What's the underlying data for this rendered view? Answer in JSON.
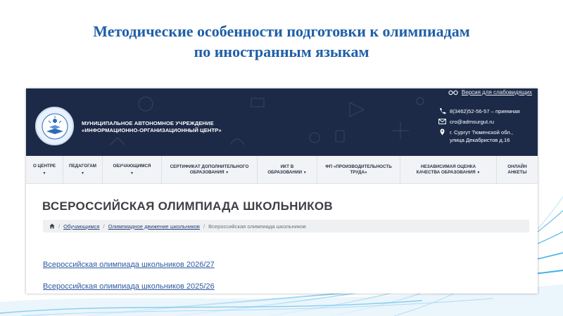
{
  "slide": {
    "title_line1": "Методические особенности подготовки к олимпиадам",
    "title_line2": "по иностранным языкам",
    "title_color": "#1f5fa8"
  },
  "site": {
    "header": {
      "low_vision_link": "Версия для слабовидящих",
      "org_name_line1": "МУНИЦИПАЛЬНОЕ АВТОНОМНОЕ УЧРЕЖДЕНИЕ",
      "org_name_line2": "«ИНФОРМАЦИОННО-ОРГАНИЗАЦИОННЫЙ ЦЕНТР»",
      "phone": "8(3462)52-56-57 – приемная",
      "email": "cro@admsurgut.ru",
      "address_line1": "г. Сургут Тюменской обл.,",
      "address_line2": "улица Декабристов д.16",
      "background_color": "#1c2a48"
    },
    "nav": [
      {
        "line1": "О ЦЕНТРЕ",
        "line2": "",
        "caret": "▼"
      },
      {
        "line1": "ПЕДАГОГАМ",
        "line2": "",
        "caret": "▼"
      },
      {
        "line1": "ОБУЧАЮЩИМСЯ",
        "line2": "",
        "caret": "▼"
      },
      {
        "line1": "СЕРТИФИКАТ ДОПОЛНИТЕЛЬНОГО",
        "line2": "ОБРАЗОВАНИЯ",
        "caret": "▼"
      },
      {
        "line1": "ИКТ В",
        "line2": "ОБРАЗОВАНИИ",
        "caret": "▼"
      },
      {
        "line1": "ФП «ПРОИЗВОДИТЕЛЬНОСТЬ",
        "line2": "ТРУДА»",
        "caret": ""
      },
      {
        "line1": "НЕЗАВИСИМАЯ ОЦЕНКА",
        "line2": "КАЧЕСТВА ОБРАЗОВАНИЯ",
        "caret": "▼"
      },
      {
        "line1": "ОНЛАЙН",
        "line2": "АНКЕТЫ",
        "caret": ""
      }
    ],
    "page_heading": "ВСЕРОССИЙСКАЯ ОЛИМПИАДА ШКОЛЬНИКОВ",
    "breadcrumb": {
      "sep": "/",
      "item1": "Обучающимся",
      "item2": "Олимпиадное движение школьников",
      "current": "Всероссийская олимпиада школьников"
    },
    "links": [
      "Всероссийская олимпиада школьников 2026/27",
      "Всероссийская олимпиада школьников 2025/26"
    ],
    "link_color": "#2c5aa0"
  }
}
